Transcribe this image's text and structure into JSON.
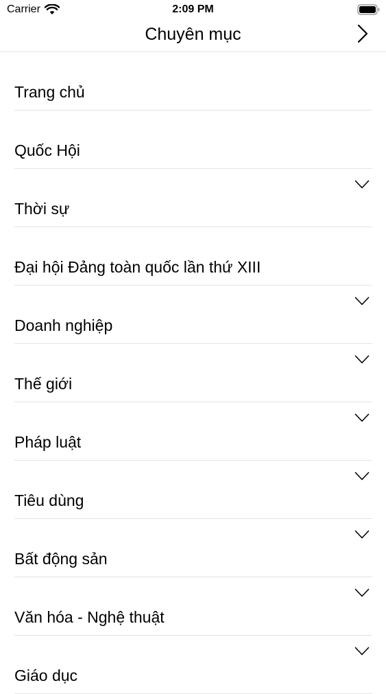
{
  "status_bar": {
    "carrier": "Carrier",
    "time": "2:09 PM"
  },
  "nav": {
    "title": "Chuyên mục"
  },
  "menu": {
    "items": [
      {
        "label": "Trang chủ",
        "expandable": false
      },
      {
        "label": "Quốc Hội",
        "expandable": false
      },
      {
        "label": "Thời sự",
        "expandable": true
      },
      {
        "label": "Đại hội Đảng toàn quốc lần thứ XIII",
        "expandable": false
      },
      {
        "label": "Doanh nghiệp",
        "expandable": true
      },
      {
        "label": "Thế giới",
        "expandable": true
      },
      {
        "label": "Pháp luật",
        "expandable": true
      },
      {
        "label": "Tiêu dùng",
        "expandable": true
      },
      {
        "label": "Bất động sản",
        "expandable": true
      },
      {
        "label": "Văn hóa - Nghệ thuật",
        "expandable": true
      },
      {
        "label": "Giáo dục",
        "expandable": true
      }
    ]
  }
}
